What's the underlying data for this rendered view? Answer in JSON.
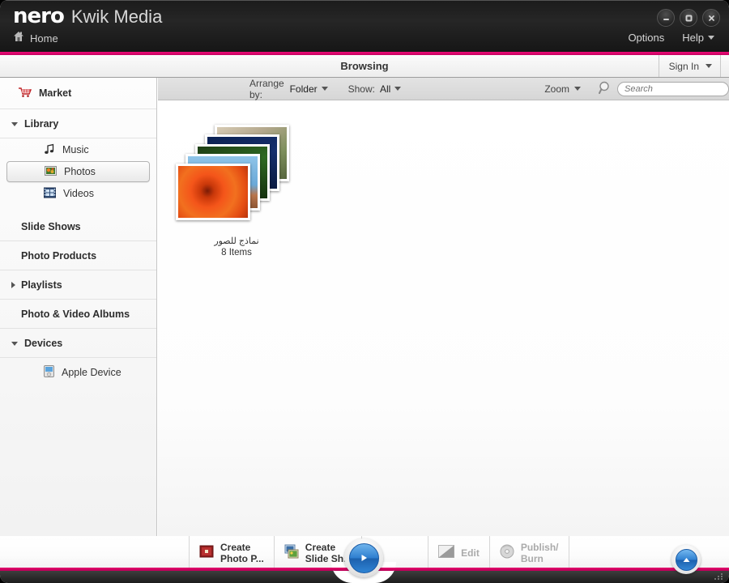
{
  "window": {
    "brand_primary": "nero",
    "brand_secondary": "Kwik Media",
    "home_label": "Home",
    "controls": [
      {
        "name": "minimize",
        "glyph": "–"
      },
      {
        "name": "maximize",
        "glyph": "■"
      },
      {
        "name": "close",
        "glyph": "✕"
      }
    ],
    "menu": [
      {
        "label": "Options",
        "has_caret": false
      },
      {
        "label": "Help",
        "has_caret": true
      }
    ],
    "accent_color": "#e5006d"
  },
  "header": {
    "title": "Browsing",
    "sign_in": "Sign In"
  },
  "toolbar": {
    "arrange_label": "Arrange by:",
    "arrange_value": "Folder",
    "show_label": "Show:",
    "show_value": "All",
    "zoom_label": "Zoom",
    "search_placeholder": "Search",
    "search_value": ""
  },
  "sidebar": {
    "market": "Market",
    "library": "Library",
    "library_children": [
      {
        "label": "Music",
        "icon": "music-note-icon",
        "selected": false
      },
      {
        "label": "Photos",
        "icon": "photos-icon",
        "selected": true
      },
      {
        "label": "Videos",
        "icon": "videos-icon",
        "selected": false
      }
    ],
    "groups": [
      {
        "label": "Slide Shows",
        "expandable": false,
        "expanded": false
      },
      {
        "label": "Photo Products",
        "expandable": false,
        "expanded": false
      },
      {
        "label": "Playlists",
        "expandable": true,
        "expanded": false
      },
      {
        "label": "Photo & Video Albums",
        "expandable": false,
        "expanded": false
      },
      {
        "label": "Devices",
        "expandable": true,
        "expanded": true
      }
    ],
    "devices_children": [
      {
        "label": "Apple Device",
        "icon": "apple-device-icon"
      }
    ]
  },
  "content": {
    "items": [
      {
        "caption": "نماذج للصور",
        "count": "8 Items"
      }
    ]
  },
  "bottombar": {
    "buttons": [
      {
        "name": "create-photo-product",
        "line1": "Create",
        "line2": "Photo P...",
        "icon": "photo-product-icon",
        "disabled": false
      },
      {
        "name": "create-slide-show",
        "line1": "Create",
        "line2": "Slide Sh...",
        "icon": "slide-show-icon",
        "disabled": false
      },
      {
        "name": "edit",
        "line1": "Edit",
        "line2": "",
        "icon": "edit-icon",
        "disabled": true
      },
      {
        "name": "publish-burn",
        "line1": "Publish/",
        "line2": "Burn",
        "icon": "burn-disc-icon",
        "disabled": true
      }
    ]
  }
}
